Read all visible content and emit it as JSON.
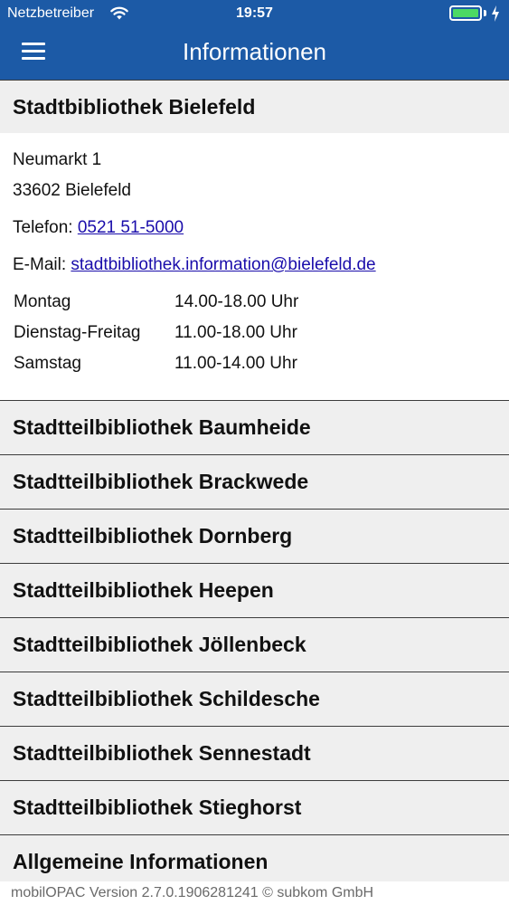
{
  "status_bar": {
    "carrier": "Netzbetreiber",
    "time": "19:57",
    "wifi_icon": "wifi-icon",
    "battery_icon": "battery-icon",
    "battery_color": "#4cd964"
  },
  "nav": {
    "title": "Informationen",
    "menu_icon": "hamburger-menu-icon",
    "background": "#1c5aa6"
  },
  "main_library": {
    "name": "Stadtbibliothek Bielefeld",
    "address_line1": "Neumarkt 1",
    "address_line2": "33602 Bielefeld",
    "phone_label": "Telefon:",
    "phone": "0521 51-5000",
    "email_label": "E-Mail:",
    "email": "stadtbibliothek.information@bielefeld.de",
    "hours": [
      {
        "day": "Montag",
        "time": "14.00-18.00 Uhr"
      },
      {
        "day": "Dienstag-Freitag",
        "time": "11.00-18.00 Uhr"
      },
      {
        "day": "Samstag",
        "time": "11.00-14.00 Uhr"
      }
    ]
  },
  "branches": [
    {
      "name": "Stadtteilbibliothek Baumheide"
    },
    {
      "name": "Stadtteilbibliothek Brackwede"
    },
    {
      "name": "Stadtteilbibliothek Dornberg"
    },
    {
      "name": "Stadtteilbibliothek Heepen"
    },
    {
      "name": "Stadtteilbibliothek Jöllenbeck"
    },
    {
      "name": "Stadtteilbibliothek Schildesche"
    },
    {
      "name": "Stadtteilbibliothek Sennestadt"
    },
    {
      "name": "Stadtteilbibliothek Stieghorst"
    },
    {
      "name": "Allgemeine Informationen"
    }
  ],
  "footer": {
    "text": "mobilOPAC Version 2.7.0.1906281241 © subkom GmbH"
  }
}
